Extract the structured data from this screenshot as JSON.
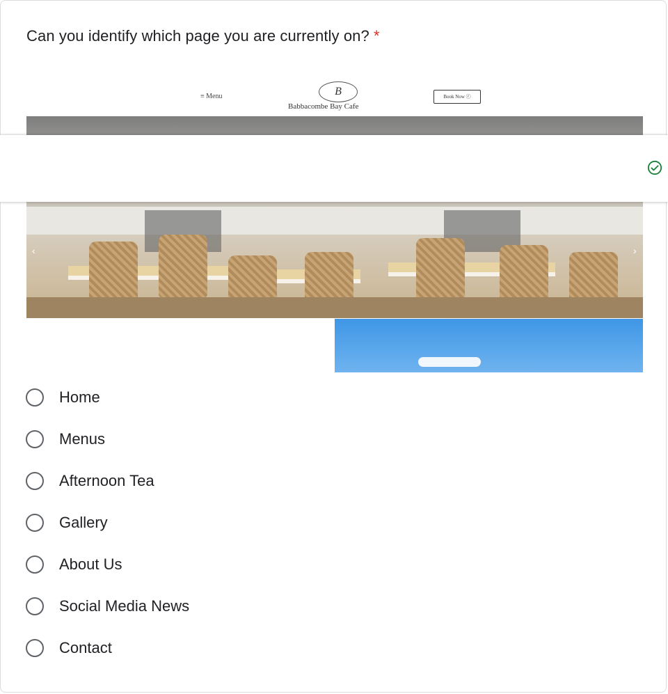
{
  "question": {
    "text": "Can you identify which page you are currently on?",
    "required_mark": "*"
  },
  "image": {
    "site_menu": "≡ Menu",
    "site_logo": "B",
    "site_name": "Babbacombe Bay Cafe",
    "site_book": "Book Now ⓡ",
    "prev_arrow": "‹",
    "next_arrow": "›"
  },
  "banner": {
    "status_icon": "check-circle-icon",
    "status_color": "#188038"
  },
  "options": [
    {
      "label": "Home"
    },
    {
      "label": "Menus"
    },
    {
      "label": "Afternoon Tea"
    },
    {
      "label": "Gallery"
    },
    {
      "label": "About Us"
    },
    {
      "label": "Social Media News"
    },
    {
      "label": "Contact"
    }
  ]
}
